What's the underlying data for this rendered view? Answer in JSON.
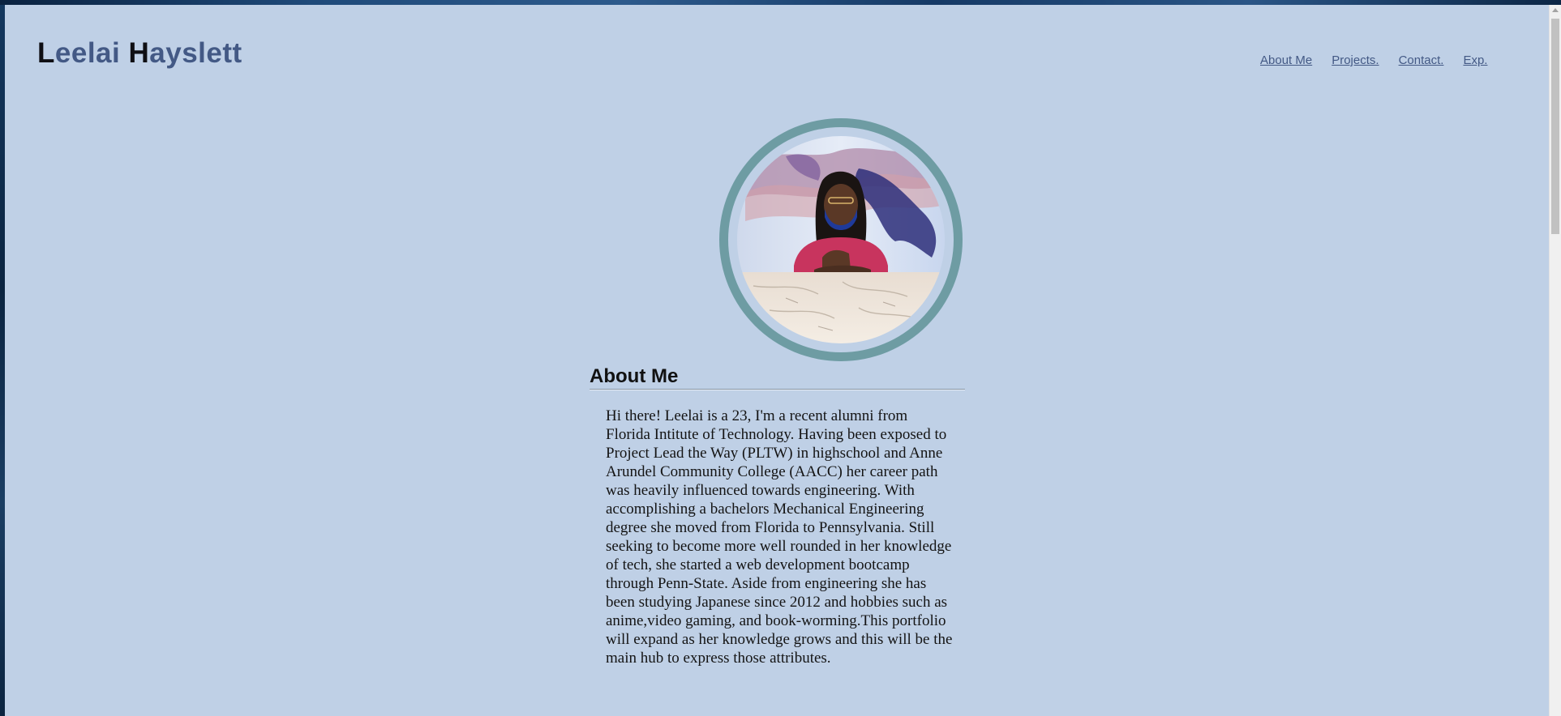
{
  "header": {
    "brand_first_initial": "L",
    "brand_first_rest": "eelai",
    "brand_last_initial": "H",
    "brand_last_rest": "ayslett"
  },
  "nav": {
    "items": [
      {
        "label": "About Me"
      },
      {
        "label": "Projects."
      },
      {
        "label": "Contact."
      },
      {
        "label": "Exp."
      }
    ]
  },
  "about": {
    "heading": "About Me",
    "body": "Hi there! Leelai is a 23, I'm a recent alumni from Florida Intitute of Technology. Having been exposed to Project Lead the Way (PLTW) in highschool and Anne Arundel Community College (AACC) her career path was heavily influenced towards engineering. With accomplishing a bachelors Mechanical Engineering degree she moved from Florida to Pennsylvania. Still seeking to become more well rounded in her knowledge of tech, she started a web development bootcamp through Penn-State. Aside from engineering she has been studying Japanese since 2012 and hobbies such as anime,video gaming, and book-worming.This portfolio will expand as her knowledge grows and this will be the main hub to express those attributes."
  },
  "colors": {
    "page_background": "#bfd0e6",
    "brand_text": "#435985",
    "brand_initials": "#0f0f14",
    "avatar_ring": "#6e9ca3",
    "nav_link": "#435985"
  }
}
